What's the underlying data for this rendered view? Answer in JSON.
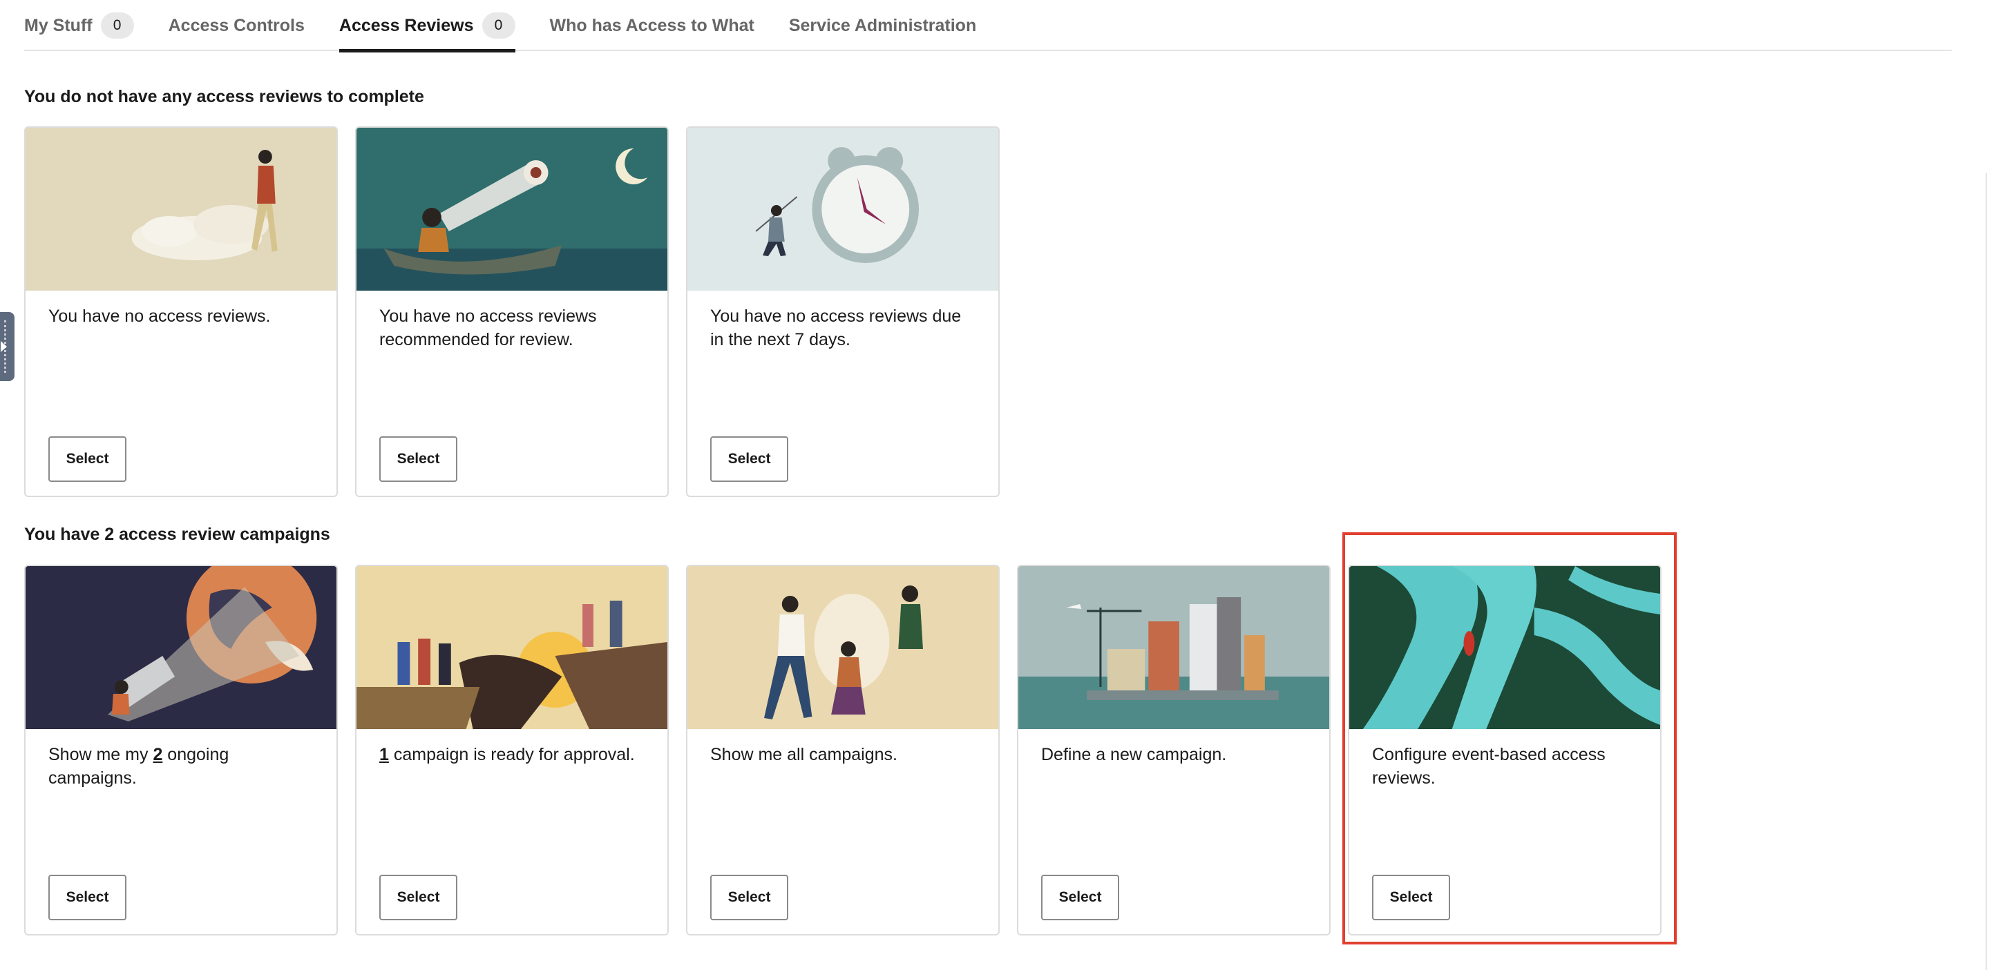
{
  "tabs": [
    {
      "label": "My Stuff",
      "count": "0"
    },
    {
      "label": "Access Controls"
    },
    {
      "label": "Access Reviews",
      "count": "0",
      "active": true
    },
    {
      "label": "Who has Access to What"
    },
    {
      "label": "Service Administration"
    }
  ],
  "sections": {
    "reviews_title": "You do not have any access reviews to complete",
    "campaigns_title": "You have 2 access review campaigns"
  },
  "review_cards": [
    {
      "text": "You have no access reviews.",
      "button": "Select"
    },
    {
      "text": "You have no access reviews recommended for review.",
      "button": "Select"
    },
    {
      "text": "You have no access reviews due in the next 7 days.",
      "button": "Select"
    }
  ],
  "campaign_cards": [
    {
      "text_before": "Show me my ",
      "link": "2",
      "text_after": " ongoing campaigns.",
      "button": "Select"
    },
    {
      "text_before": "",
      "link": "1",
      "text_after": " campaign is ready for approval.",
      "button": "Select"
    },
    {
      "text_before": "Show me all campaigns.",
      "link": "",
      "text_after": "",
      "button": "Select"
    },
    {
      "text_before": "Define a new campaign.",
      "link": "",
      "text_after": "",
      "button": "Select"
    },
    {
      "text_before": "Configure event-based access reviews.",
      "link": "",
      "text_after": "",
      "button": "Select"
    }
  ],
  "colors": {
    "accent_highlight": "#e0402e",
    "tab_active": "#1b1b1b",
    "tab_inactive": "#666666"
  }
}
